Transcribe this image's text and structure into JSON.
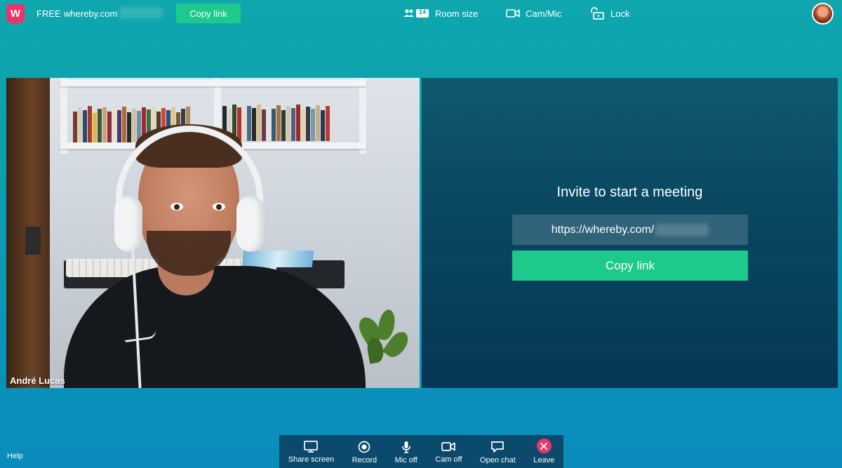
{
  "header": {
    "logo_letter": "W",
    "plan": "FREE",
    "domain": "whereby.com",
    "copy_link_label": "Copy link",
    "room_size": {
      "badge": "14",
      "label": "Room size"
    },
    "cam_mic_label": "Cam/Mic",
    "lock_label": "Lock"
  },
  "video": {
    "participant_name": "André Lucas"
  },
  "invite": {
    "title": "Invite to start a meeting",
    "url": "https://whereby.com/",
    "copy_link_label": "Copy link"
  },
  "footer": {
    "help_label": "Help"
  },
  "toolbar": {
    "items": [
      {
        "label": "Share screen",
        "icon": "monitor-icon"
      },
      {
        "label": "Record",
        "icon": "record-icon"
      },
      {
        "label": "Mic off",
        "icon": "microphone-icon"
      },
      {
        "label": "Cam off",
        "icon": "camera-icon"
      },
      {
        "label": "Open chat",
        "icon": "chat-icon"
      },
      {
        "label": "Leave",
        "icon": "close-icon"
      }
    ]
  },
  "colors": {
    "brand": "#e8336b",
    "accent_green": "#1dc98b",
    "leave_red": "#ea3668",
    "toolbar_bg": "#0b4a6c"
  }
}
